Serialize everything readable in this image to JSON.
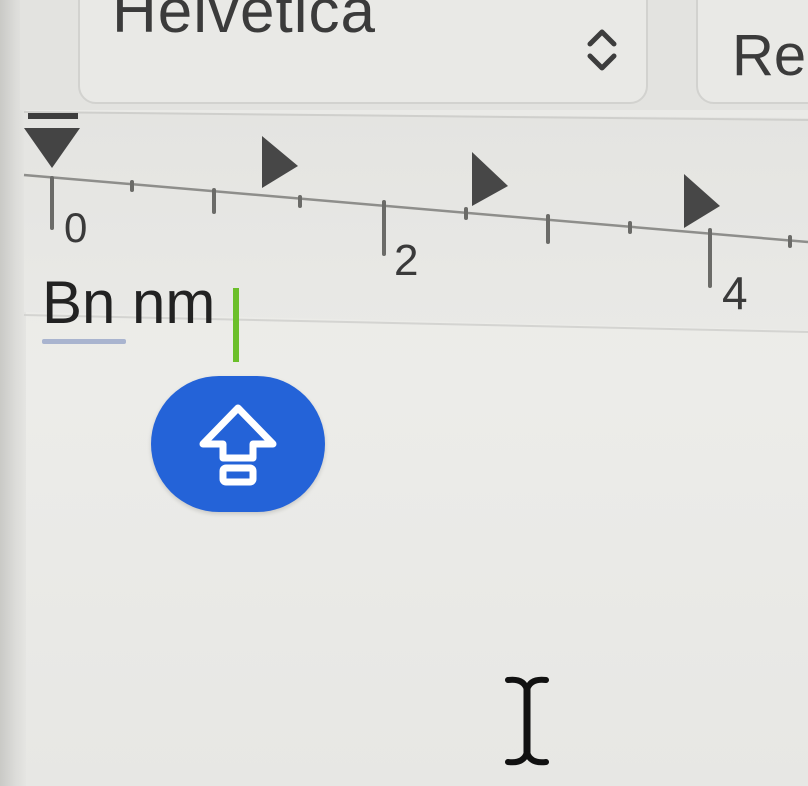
{
  "toolbar": {
    "font_family": "Helvetica",
    "font_style": "Re"
  },
  "ruler": {
    "labels": [
      "0",
      "2",
      "4"
    ]
  },
  "document": {
    "text": "Bn nm"
  },
  "caps_lock_indicator": {
    "icon": "caps-lock-icon",
    "color": "#2463d8"
  },
  "cursor": {
    "icon": "i-beam-cursor-icon"
  },
  "colors": {
    "caret": "#6bbf2a",
    "spell_underline": "#a9b4cf"
  }
}
